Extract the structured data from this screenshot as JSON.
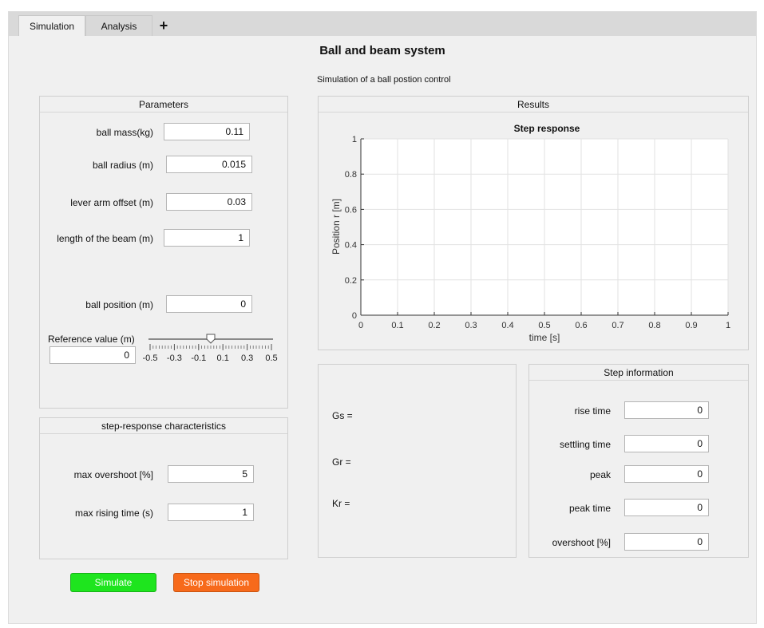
{
  "tabs": [
    {
      "label": "Simulation",
      "active": true
    },
    {
      "label": "Analysis",
      "active": false
    }
  ],
  "add_tab_symbol": "+",
  "title": "Ball and beam system",
  "subtitle": "Simulation of a ball postion control",
  "parameters": {
    "title": "Parameters",
    "ball_mass_label": "ball mass(kg)",
    "ball_mass": "0.11",
    "ball_radius_label": "ball radius (m)",
    "ball_radius": "0.015",
    "lever_label": "lever arm offset (m)",
    "lever": "0.03",
    "length_label": "length of the beam (m)",
    "length": "1",
    "position_label": "ball position (m)",
    "position": "0",
    "reference_label": "Reference value (m)",
    "reference": "0",
    "slider_value": 0,
    "slider_ticks": [
      "-0.5",
      "-0.3",
      "-0.1",
      "0.1",
      "0.3",
      "0.5"
    ]
  },
  "characteristics": {
    "title": "step-response characteristics",
    "overshoot_label": "max overshoot [%]",
    "overshoot": "5",
    "rising_label": "max rising time (s)",
    "rising": "1"
  },
  "buttons": {
    "simulate": "Simulate",
    "stop": "Stop simulation"
  },
  "results": {
    "title": "Results"
  },
  "chart_data": {
    "type": "line",
    "title": "Step response",
    "xlabel": "time [s]",
    "ylabel": "Position  r [m]",
    "xlim": [
      0,
      1
    ],
    "ylim": [
      0,
      1
    ],
    "xticks": [
      "0",
      "0.1",
      "0.2",
      "0.3",
      "0.4",
      "0.5",
      "0.6",
      "0.7",
      "0.8",
      "0.9",
      "1"
    ],
    "yticks": [
      "0",
      "0.2",
      "0.4",
      "0.6",
      "0.8",
      "1"
    ],
    "grid": true,
    "series": []
  },
  "transfer": {
    "gs": "Gs =",
    "gr": "Gr =",
    "kr": "Kr ="
  },
  "step_info": {
    "title": "Step information",
    "rise_label": "rise time",
    "rise": "0",
    "settling_label": "settling time",
    "settling": "0",
    "peak_label": "peak",
    "peak": "0",
    "peak_time_label": "peak time",
    "peak_time": "0",
    "overshoot_label": "overshoot [%]",
    "overshoot": "0"
  },
  "colors": {
    "simulate": "#1ee51e",
    "stop": "#f76a1b",
    "background": "#f0f0f0"
  }
}
